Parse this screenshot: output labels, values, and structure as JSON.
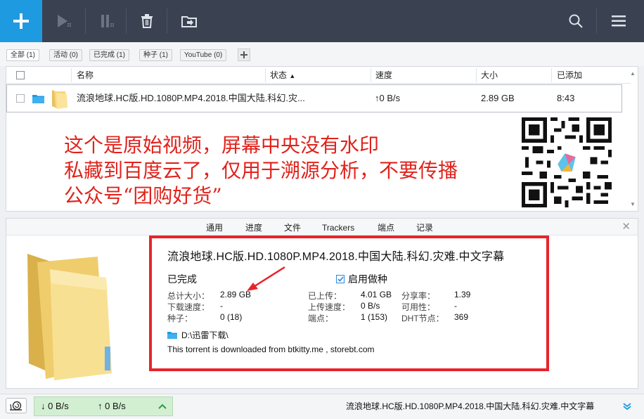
{
  "toolbar": {
    "icons": [
      "plus-icon",
      "play-icon",
      "pause-icon",
      "trash-icon",
      "move-icon",
      "search-icon",
      "menu-icon"
    ]
  },
  "filters": [
    {
      "label": "全部 (1)",
      "active": true
    },
    {
      "label": "活动 (0)",
      "active": false
    },
    {
      "label": "已完成 (1)",
      "active": false
    },
    {
      "label": "种子 (1)",
      "active": false
    },
    {
      "label": "YouTube (0)",
      "active": false
    }
  ],
  "table": {
    "headers": {
      "name": "名称",
      "status": "状态",
      "speed": "速度",
      "size": "大小",
      "added": "已添加"
    },
    "row": {
      "name": "流浪地球.HC版.HD.1080P.MP4.2018.中国大陆.科幻.灾...",
      "speed": "0 B/s",
      "size": "2.89 GB",
      "added": "8:43"
    }
  },
  "watermark": {
    "line1": "这个是原始视频，屏幕中央没有水印",
    "line2": "私藏到百度云了，仅用于溯源分析，不要传播",
    "line3": "公众号“团购好货”"
  },
  "details": {
    "tabs": [
      "通用",
      "进度",
      "文件",
      "Trackers",
      "端点",
      "记录"
    ],
    "title": "流浪地球.HC版.HD.1080P.MP4.2018.中国大陆.科幻.灾难.中文字幕",
    "status": "已完成",
    "seeding_label": "启用做种",
    "fields": {
      "total_size_label": "总计大小：",
      "total_size": "2.89 GB",
      "dl_speed_label": "下载速度：",
      "dl_speed": "-",
      "seeds_label": "种子：",
      "seeds": "0 (18)",
      "uploaded_label": "已上传：",
      "uploaded": "4.01 GB",
      "ul_speed_label": "上传速度：",
      "ul_speed": "0 B/s",
      "peers_label": "端点：",
      "peers": "1 (153)",
      "ratio_label": "分享率：",
      "ratio": "1.39",
      "availability_label": "可用性：",
      "availability": "-",
      "dht_label": "DHT节点：",
      "dht": "369"
    },
    "path": "D:\\迅雷下载\\",
    "source_note": "This torrent is downloaded from btkitty.me , storebt.com"
  },
  "statusbar": {
    "down_speed": "0 B/s",
    "up_speed": "0 B/s",
    "task_name": "流浪地球.HC版.HD.1080P.MP4.2018.中国大陆.科幻.灾难.中文字幕"
  },
  "colors": {
    "accent": "#1e9ae0",
    "toolbar": "#3a4252",
    "annotation": "#e8242b",
    "speed_bg": "#d3efd2"
  }
}
